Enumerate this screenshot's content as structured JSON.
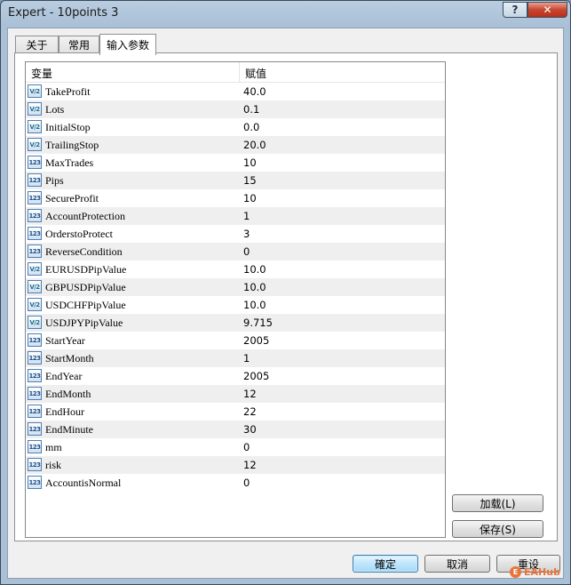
{
  "window": {
    "title": "Expert - 10points 3",
    "help_label": "?",
    "close_label": "✕"
  },
  "tabs": [
    {
      "label": "关于",
      "active": false
    },
    {
      "label": "常用",
      "active": false
    },
    {
      "label": "输入参数",
      "active": true
    }
  ],
  "table": {
    "columns": [
      "变量",
      "赋值"
    ],
    "rows": [
      {
        "name": "TakeProfit",
        "value": "40.0",
        "icon": "V/2"
      },
      {
        "name": "Lots",
        "value": "0.1",
        "icon": "V/2"
      },
      {
        "name": "InitialStop",
        "value": "0.0",
        "icon": "V/2"
      },
      {
        "name": "TrailingStop",
        "value": "20.0",
        "icon": "V/2"
      },
      {
        "name": "MaxTrades",
        "value": "10",
        "icon": "123"
      },
      {
        "name": "Pips",
        "value": "15",
        "icon": "123"
      },
      {
        "name": "SecureProfit",
        "value": "10",
        "icon": "123"
      },
      {
        "name": "AccountProtection",
        "value": "1",
        "icon": "123"
      },
      {
        "name": "OrderstoProtect",
        "value": "3",
        "icon": "123"
      },
      {
        "name": "ReverseCondition",
        "value": "0",
        "icon": "123"
      },
      {
        "name": "EURUSDPipValue",
        "value": "10.0",
        "icon": "V/2"
      },
      {
        "name": "GBPUSDPipValue",
        "value": "10.0",
        "icon": "V/2"
      },
      {
        "name": "USDCHFPipValue",
        "value": "10.0",
        "icon": "V/2"
      },
      {
        "name": "USDJPYPipValue",
        "value": "9.715",
        "icon": "V/2"
      },
      {
        "name": "StartYear",
        "value": "2005",
        "icon": "123"
      },
      {
        "name": "StartMonth",
        "value": "1",
        "icon": "123"
      },
      {
        "name": "EndYear",
        "value": "2005",
        "icon": "123"
      },
      {
        "name": "EndMonth",
        "value": "12",
        "icon": "123"
      },
      {
        "name": "EndHour",
        "value": "22",
        "icon": "123"
      },
      {
        "name": "EndMinute",
        "value": "30",
        "icon": "123"
      },
      {
        "name": "mm",
        "value": "0",
        "icon": "123"
      },
      {
        "name": "risk",
        "value": "12",
        "icon": "123"
      },
      {
        "name": "AccountisNormal",
        "value": "0",
        "icon": "123"
      }
    ]
  },
  "side_buttons": {
    "load": "加载(L)",
    "save": "保存(S)"
  },
  "bottom_buttons": {
    "ok": "確定",
    "cancel": "取消",
    "reset": "重设"
  },
  "watermark": {
    "text": "EAHub"
  },
  "colors": {
    "default_button": "#bee6fd",
    "alt_row": "#efefef"
  }
}
